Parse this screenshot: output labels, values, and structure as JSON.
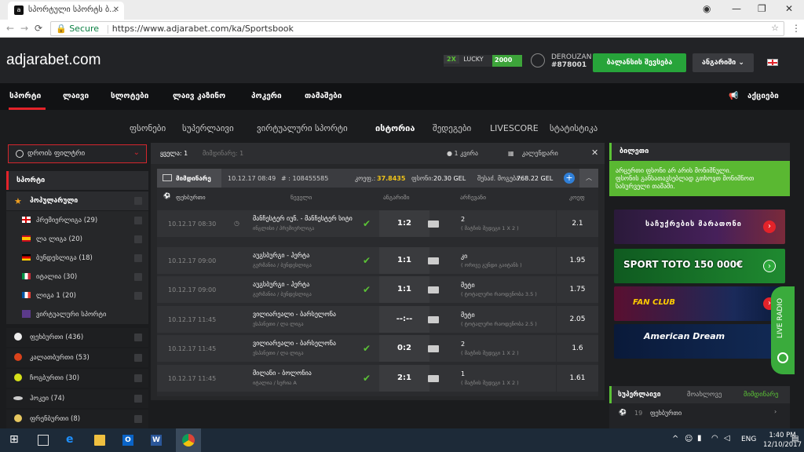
{
  "browser": {
    "tab_title": "სპორტული სპორტს ბ...",
    "url_secure": "Secure",
    "url": "https://www.adjarabet.com/ka/Sportsbook"
  },
  "header": {
    "logo": "adjarabet.com",
    "lucky_multiplier": "2X",
    "lucky_label": "LUCKY",
    "lucky_points": "2000",
    "username": "DEROUZAN",
    "user_id": "#878001",
    "balance_button": "ბალანსის შევსება",
    "account_button": "ანგარიში",
    "colors": {
      "accent_red": "#e3232a",
      "green": "#27a43a"
    }
  },
  "main_nav": {
    "items": [
      "სპორტი",
      "ლაივი",
      "სლოტები",
      "ლაივ კაზინო",
      "პოკერი",
      "თამაშები"
    ],
    "promo": "აქციები"
  },
  "sub_nav": {
    "items": [
      "ფსონები",
      "სუპერლაივი",
      "ვირტუალური სპორტი",
      "ისტორია",
      "შედეგები",
      "LIVESCORE",
      "სტატისტიკა"
    ],
    "active": "ისტორია"
  },
  "sidebar": {
    "time_filter": "დროის ფილტრი",
    "sports_label": "სპორტი",
    "popular_label": "პოპულარული",
    "popular_items": [
      {
        "label": "პრემიერლიგა (29)",
        "flag": "england"
      },
      {
        "label": "ლა ლიგა (20)",
        "flag": "spain"
      },
      {
        "label": "ბუნდესლიგა (18)",
        "flag": "germany"
      },
      {
        "label": "იტალია (30)",
        "flag": "italy"
      },
      {
        "label": "ლიგა 1 (20)",
        "flag": "france"
      },
      {
        "label": "ვირტუალური სპორტი",
        "flag": "virtual"
      }
    ],
    "sports": [
      {
        "label": "ფეხბურთი (436)",
        "icon": "soccer-icon"
      },
      {
        "label": "კალათბურთი (53)",
        "icon": "basketball-icon"
      },
      {
        "label": "ჩოგბურთი (30)",
        "icon": "tennis-icon"
      },
      {
        "label": "ჰოკეი (74)",
        "icon": "hockey-icon"
      },
      {
        "label": "ფრენბურთი (8)",
        "icon": "volleyball-icon"
      }
    ]
  },
  "center": {
    "tabs": {
      "simple": "ყველა: 1",
      "sub": "მიმდინარე: 1",
      "count": "1 კვირა",
      "calendar": "კალენდარი"
    },
    "card": {
      "tab": "მიმდინარე",
      "date": "10.12.17 08:49",
      "number": "# : 108455585",
      "coef_label": "კოეფ.:",
      "coef_value": "37.8435",
      "stake_label": "ფსონი:",
      "stake_value": "20.30 GEL",
      "win_label": "შესაძ. მოგება:",
      "win_value": "768.22 GEL"
    },
    "columns": [
      "ფეხბურთი",
      "ნეველი",
      "ანგარიში",
      "არჩევანი",
      "კოეფ"
    ],
    "rows": [
      {
        "date": "10.12.17 08:30",
        "teams": "მანჩესტერ იუნ. - მანჩესტერ სიტი",
        "league": "ინგლისი / პრემიერლიგა",
        "score": "1:2",
        "outcome": "2",
        "outcome_sub": "( მატჩის შედეგი 1 X 2 )",
        "odds": "2.1",
        "won": true
      },
      {
        "date": "10.12.17 09:00",
        "teams": "აუგსბურგი - ჰერტა",
        "league": "გერმანია / ბუნდესლიგა",
        "score": "1:1",
        "outcome": "კი",
        "outcome_sub": "( ორივე გუნდი გაიტანს )",
        "odds": "1.95",
        "won": true
      },
      {
        "date": "10.12.17 09:00",
        "teams": "აუგსბურგი - ჰერტა",
        "league": "გერმანია / ბუნდესლიგა",
        "score": "1:1",
        "outcome": "მეტი",
        "outcome_sub": "( ტოტალური რაოდენობა 3.5 )",
        "odds": "1.75",
        "won": true
      },
      {
        "date": "10.12.17 11:45",
        "teams": "ვილიარეალი - ბარსელონა",
        "league": "ესპანეთი / ლა ლიგა",
        "score": "--:--",
        "outcome": "მეტი",
        "outcome_sub": "( ტოტალური რაოდენობა 2.5 )",
        "odds": "2.05",
        "won": false
      },
      {
        "date": "10.12.17 11:45",
        "teams": "ვილიარეალი - ბარსელონა",
        "league": "ესპანეთი / ლა ლიგა",
        "score": "0:2",
        "outcome": "2",
        "outcome_sub": "( მატჩის შედეგი 1 X 2 )",
        "odds": "1.6",
        "won": true
      },
      {
        "date": "10.12.17 11:45",
        "teams": "მილანი - ბოლონია",
        "league": "იტალია / სერია A",
        "score": "2:1",
        "outcome": "1",
        "outcome_sub": "( მატჩის შედეგი 1 X 2 )",
        "odds": "1.61",
        "won": true
      }
    ]
  },
  "right": {
    "ticket_title": "ბილეთი",
    "ticket_msg_1": "არცერთი ფსონი არ არის მონიშნული.",
    "ticket_msg_2": "ფსონის განსათავსებლად გთხოვთ მონიშნოთ",
    "ticket_msg_3": "სასურველი თამაში.",
    "banners": [
      {
        "text": "საჩუქრების მარათონი"
      },
      {
        "text": "SPORT TOTO 150 000€"
      },
      {
        "text": "FAN CLUB"
      },
      {
        "text": "American Dream"
      }
    ],
    "live_radio": "LIVE RADIO",
    "superlive_tabs": [
      "სუპერლაივი",
      "მოახლოვე",
      "მიმდინარე"
    ],
    "superlive_row": {
      "count": "19",
      "label": "ფეხბურთი"
    }
  },
  "taskbar": {
    "lang": "ENG",
    "time": "1:40 PM",
    "date": "12/10/2017"
  }
}
